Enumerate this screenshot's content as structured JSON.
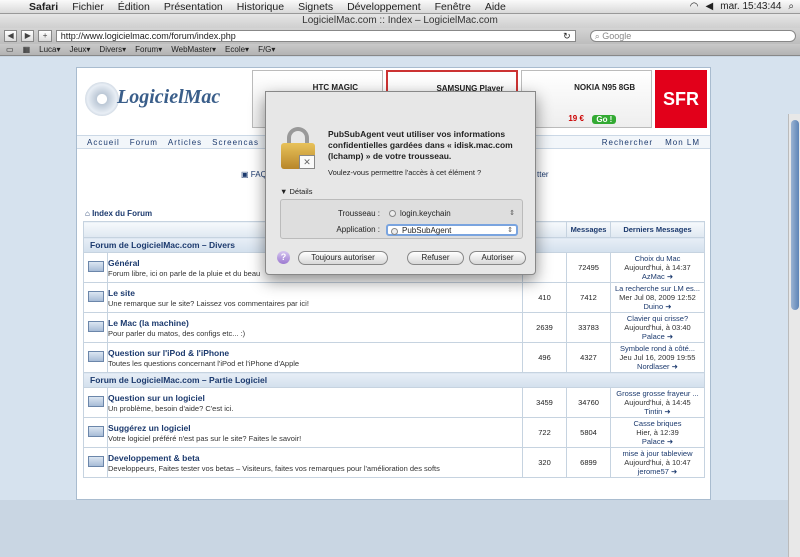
{
  "menubar": {
    "app": "Safari",
    "items": [
      "Fichier",
      "Édition",
      "Présentation",
      "Historique",
      "Signets",
      "Développement",
      "Fenêtre",
      "Aide"
    ],
    "clock": "mar. 15:43:44"
  },
  "window": {
    "title": "LogicielMac.com :: Index – LogicielMac.com"
  },
  "toolbar": {
    "url": "http://www.logicielmac.com/forum/index.php",
    "search_placeholder": "Google"
  },
  "bookmarks": [
    "Luca▾",
    "Jeux▾",
    "Divers▾",
    "Forum▾",
    "WebMaster▾",
    "Ecole▾",
    "F/G▾"
  ],
  "site": {
    "logo_text": "LogicielMac",
    "ads": [
      {
        "name": "HTC MAGIC"
      },
      {
        "name": "SAMSUNG Player One Noir"
      },
      {
        "name": "NOKIA N95 8GB",
        "price": "19 €",
        "cta": "Go !"
      }
    ],
    "sfr": "SFR",
    "nav": [
      "Accueil",
      "Forum",
      "Articles",
      "Screencas"
    ],
    "nav_right": [
      "Rechercher",
      "Mon LM"
    ],
    "faq": "FAQ",
    "faq_right": "tter",
    "breadcrumb": "Index du Forum",
    "headers": {
      "messages": "Messages",
      "last": "Derniers Messages"
    },
    "categories": [
      {
        "title": "Forum de LogicielMac.com – Divers",
        "forums": [
          {
            "name": "Général",
            "desc": "Forum libre, ici on parle de la pluie et du beau",
            "topics": "",
            "posts": "72495",
            "last_title": "Choix du Mac",
            "last_date": "Aujourd'hui, à 14:37",
            "last_user": "AzMac ➜"
          },
          {
            "name": "Le site",
            "desc": "Une remarque sur le site? Laissez vos commentaires par ici!",
            "topics": "410",
            "posts": "7412",
            "last_title": "La recherche sur LM es...",
            "last_date": "Mer Jul 08, 2009 12:52",
            "last_user": "Duino ➜"
          },
          {
            "name": "Le Mac (la machine)",
            "desc": "Pour parler du matos, des configs etc... :)",
            "topics": "2639",
            "posts": "33783",
            "last_title": "Clavier qui crisse?",
            "last_date": "Aujourd'hui, à 03:40",
            "last_user": "Palace ➜"
          },
          {
            "name": "Question sur l'iPod & l'iPhone",
            "desc": "Toutes les questions concernant l'iPod et l'iPhone d'Apple",
            "topics": "496",
            "posts": "4327",
            "last_title": "Symbole rond à côté...",
            "last_date": "Jeu Jul 16, 2009 19:55",
            "last_user": "Nordlaser ➜"
          }
        ]
      },
      {
        "title": "Forum de LogicielMac.com – Partie Logiciel",
        "forums": [
          {
            "name": "Question sur un logiciel",
            "desc": "Un problème, besoin d'aide? C'est ici.",
            "topics": "3459",
            "posts": "34760",
            "last_title": "Grosse grosse frayeur ...",
            "last_date": "Aujourd'hui, à 14:45",
            "last_user": "Tintin ➜"
          },
          {
            "name": "Suggérez un logiciel",
            "desc": "Votre logiciel préféré n'est pas sur le site? Faites le savoir!",
            "topics": "722",
            "posts": "5804",
            "last_title": "Casse briques",
            "last_date": "Hier, à 12:39",
            "last_user": "Palace ➜"
          },
          {
            "name": "Developpement & beta",
            "desc": "Developpeurs, Faites tester vos betas – Visiteurs, faites vos remarques pour l'amélioration des softs",
            "topics": "320",
            "posts": "6899",
            "last_title": "mise à jour tableview",
            "last_date": "Aujourd'hui, à 10:47",
            "last_user": "jerome57 ➜"
          }
        ]
      }
    ]
  },
  "dialog": {
    "message": "PubSubAgent veut utiliser vos informations confidentielles gardées dans « idisk.mac.com (lchamp) » de votre trousseau.",
    "question": "Voulez-vous permettre l'accès à cet élément ?",
    "details": "Détails",
    "keychain_label": "Trousseau :",
    "keychain_value": "login.keychain",
    "app_label": "Application :",
    "app_value": "PubSubAgent",
    "help": "?",
    "always": "Toujours autoriser",
    "deny": "Refuser",
    "allow": "Autoriser"
  }
}
